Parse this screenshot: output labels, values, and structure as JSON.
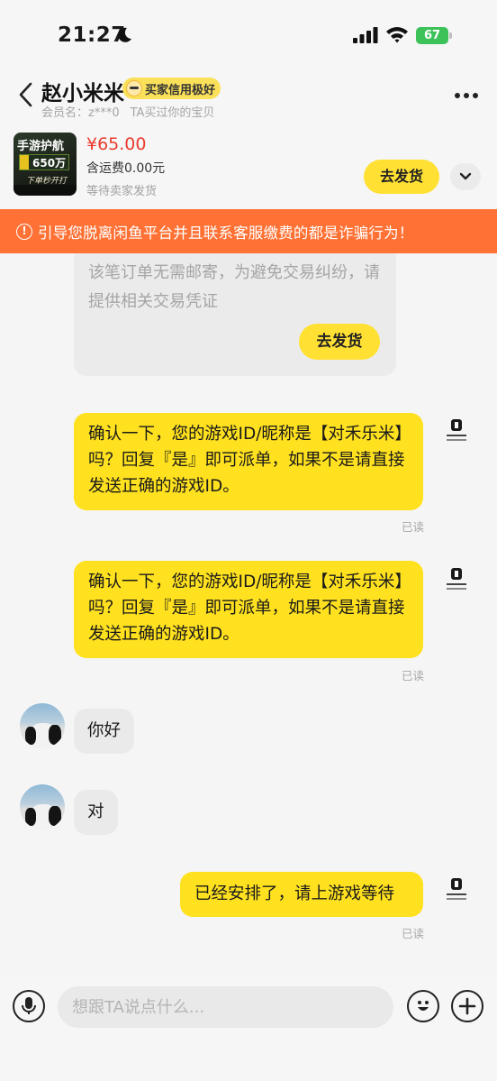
{
  "status_bar": {
    "time": "21:27",
    "battery": "67"
  },
  "header": {
    "contact_name": "赵小米米",
    "credit_badge": "买家信用极好",
    "member_label": "会员名：z***0",
    "bought_note": "TA买过你的宝贝"
  },
  "product": {
    "thumb_title": "手游护航",
    "thumb_number": "650万",
    "thumb_sub": "下单秒开打",
    "price": "¥65.00",
    "shipping": "含运费0.00元",
    "status": "等待卖家发货",
    "ship_button": "去发货"
  },
  "warning": {
    "text": "引导您脱离闲鱼平台并且联系客服缴费的都是诈骗行为！"
  },
  "system_card": {
    "text": "该笔订单无需邮寄，为避免交易纠纷，请提供相关交易凭证",
    "ship_button": "去发货"
  },
  "messages": [
    {
      "side": "out",
      "text": "确认一下，您的游戏ID/昵称是【对禾乐米】吗？回复『是』即可派单，如果不是请直接发送正确的游戏ID。",
      "status": "已读"
    },
    {
      "side": "out",
      "text": "确认一下，您的游戏ID/昵称是【对禾乐米】吗？回复『是』即可派单，如果不是请直接发送正确的游戏ID。",
      "status": "已读"
    },
    {
      "side": "in",
      "text": "你好"
    },
    {
      "side": "in",
      "text": "对"
    },
    {
      "side": "out",
      "text": "已经安排了，请上游戏等待",
      "status": "已读"
    }
  ],
  "input": {
    "placeholder": "想跟TA说点什么..."
  },
  "icons": [
    "back-icon",
    "more-icon",
    "chevron-down-icon",
    "warning-icon",
    "microphone-icon",
    "emoji-icon",
    "plus-icon",
    "seller-logo-icon",
    "user-avatar"
  ],
  "colors": {
    "accent_yellow": "#ffe11f",
    "warning_orange": "#ff7134",
    "price_red": "#ea3b2e",
    "battery_green": "#3dc25a"
  }
}
